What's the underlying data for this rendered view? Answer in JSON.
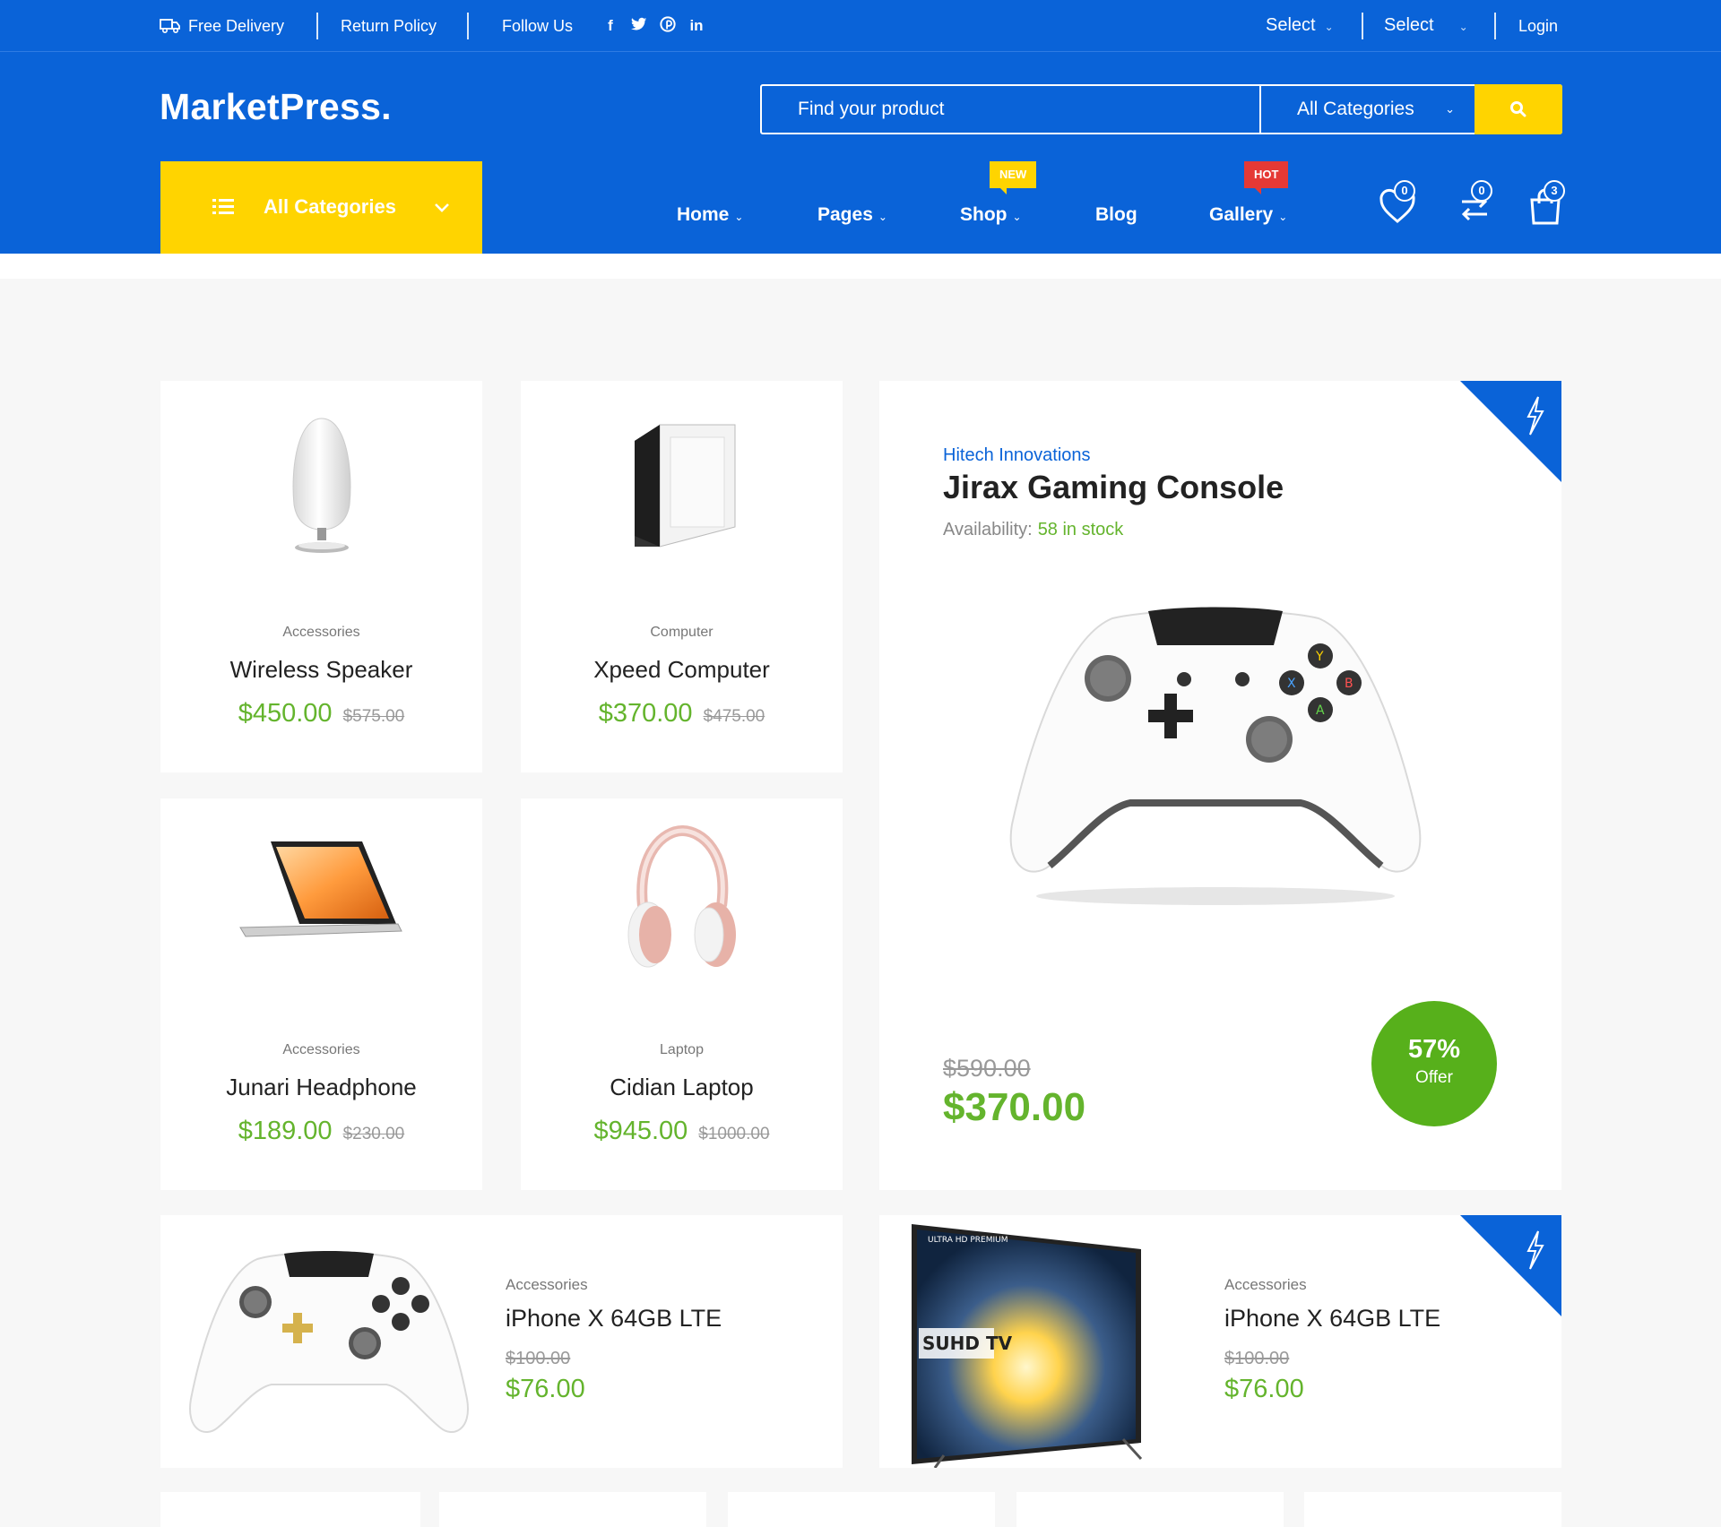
{
  "topbar": {
    "delivery": "Free Delivery",
    "return_policy": "Return Policy",
    "follow_us": "Follow Us",
    "social": [
      {
        "icon": "facebook-icon",
        "glyph": "f"
      },
      {
        "icon": "twitter-icon",
        "glyph": "🐦"
      },
      {
        "icon": "pinterest-icon",
        "glyph": "℗"
      },
      {
        "icon": "linkedin-icon",
        "glyph": "in"
      }
    ],
    "select_1": "Select",
    "select_2": "Select",
    "login": "Login"
  },
  "header": {
    "logo": "MarketPress.",
    "search_placeholder": "Find your product",
    "search_category": "All Categories",
    "all_categories": "All Categories",
    "nav": [
      {
        "label": "Home"
      },
      {
        "label": "Pages"
      },
      {
        "label": "Shop",
        "badge": "NEW"
      },
      {
        "label": "Blog"
      },
      {
        "label": "Gallery",
        "badge": "HOT"
      }
    ],
    "wishlist_count": "0",
    "compare_count": "0",
    "cart_count": "3"
  },
  "products": [
    {
      "category": "Accessories",
      "name": "Wireless Speaker",
      "price": "$450.00",
      "old_price": "$575.00"
    },
    {
      "category": "Computer",
      "name": "Xpeed Computer",
      "price": "$370.00",
      "old_price": "$475.00"
    },
    {
      "category": "Accessories",
      "name": "Junari Headphone",
      "price": "$189.00",
      "old_price": "$230.00"
    },
    {
      "category": "Laptop",
      "name": "Cidian Laptop",
      "price": "$945.00",
      "old_price": "$1000.00"
    }
  ],
  "featured": {
    "brand": "Hitech Innovations",
    "title": "Jirax Gaming Console",
    "availability_label": "Availability:",
    "availability_value": "58 in stock",
    "old_price": "$590.00",
    "price": "$370.00",
    "offer_pct": "57%",
    "offer_label": "Offer"
  },
  "wide_products": [
    {
      "category": "Accessories",
      "name": "iPhone X 64GB LTE",
      "old_price": "$100.00",
      "price": "$76.00"
    },
    {
      "category": "Accessories",
      "name": "iPhone X 64GB LTE",
      "old_price": "$100.00",
      "price": "$76.00",
      "tv_brand": "SUHD TV",
      "tv_sub": "ULTRA HD PREMIUM"
    }
  ],
  "colors": {
    "brand_blue": "#0a63d8",
    "accent_yellow": "#ffd400",
    "price_green": "#64b42d",
    "hot_red": "#e53935"
  }
}
